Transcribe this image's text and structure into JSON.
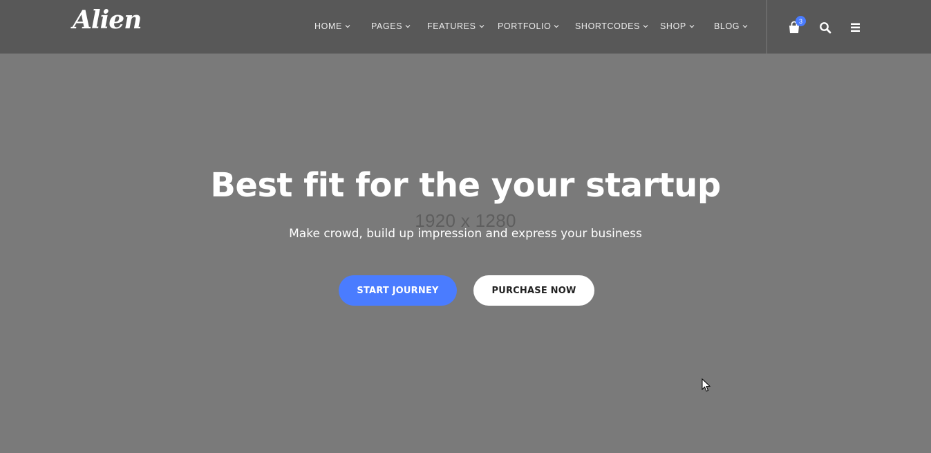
{
  "brand": {
    "logo_text": "Alien"
  },
  "nav": {
    "items": [
      {
        "label": "HOME"
      },
      {
        "label": "PAGES"
      },
      {
        "label": "FEATURES"
      },
      {
        "label": "PORTFOLIO"
      },
      {
        "label": "SHORTCODES"
      },
      {
        "label": "SHOP"
      },
      {
        "label": "BLOG"
      }
    ]
  },
  "header_icons": {
    "cart_count": "3",
    "cart_icon": "shopping-bag-icon",
    "search_icon": "search-icon",
    "menu_icon": "hamburger-menu-icon"
  },
  "hero": {
    "placeholder": "1920 x 1280",
    "headline": "Best fit for the your startup",
    "subline": "Make crowd, build up impression and express your business",
    "primary_button": "START JOURNEY",
    "secondary_button": "PURCHASE NOW"
  },
  "colors": {
    "accent": "#4a7cff",
    "header_bg": "#585858",
    "hero_bg": "#7a7a7a"
  }
}
